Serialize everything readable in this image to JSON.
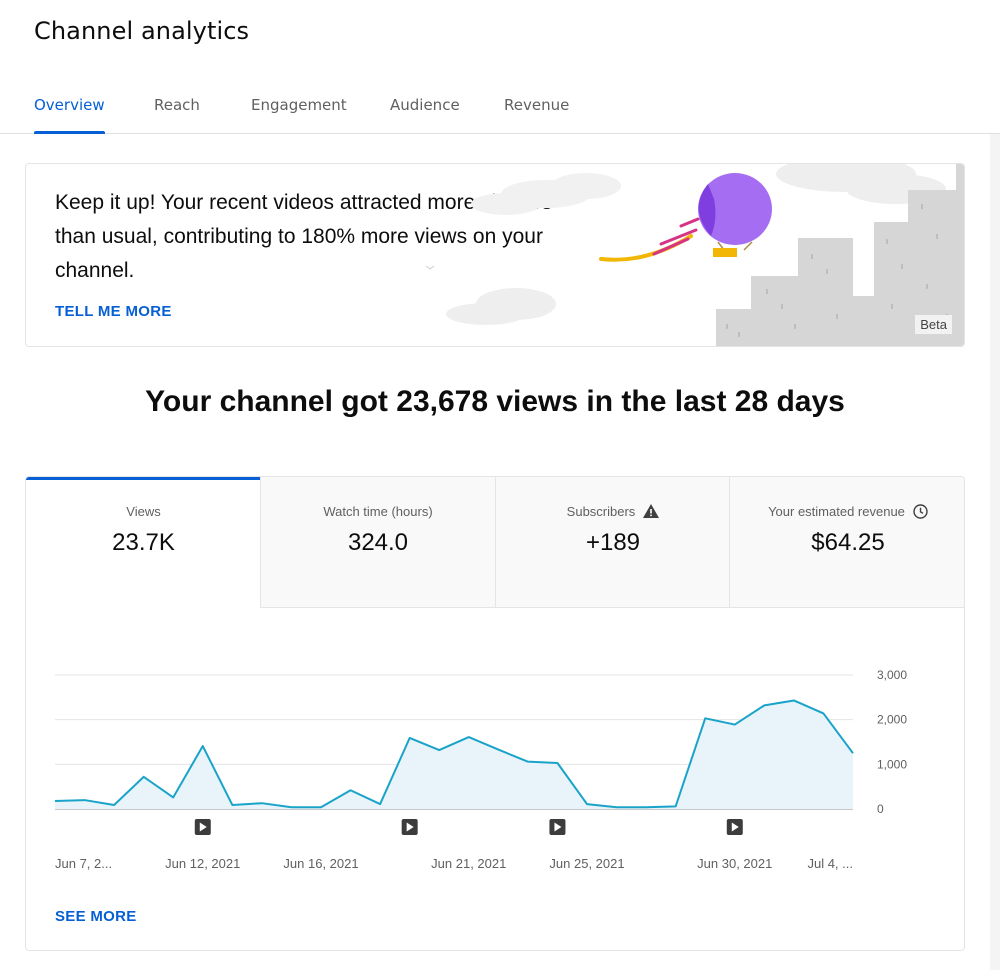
{
  "page": {
    "title": "Channel analytics"
  },
  "tabs": [
    {
      "label": "Overview",
      "active": true
    },
    {
      "label": "Reach"
    },
    {
      "label": "Engagement"
    },
    {
      "label": "Audience"
    },
    {
      "label": "Revenue"
    }
  ],
  "banner": {
    "message": "Keep it up! Your recent videos attracted more viewers than usual, contributing to 180% more views on your channel.",
    "link_label": "TELL ME MORE",
    "badge": "Beta"
  },
  "headline": "Your channel got 23,678 views in the last 28 days",
  "metrics": [
    {
      "label": "Views",
      "value": "23.7K",
      "active": true
    },
    {
      "label": "Watch time (hours)",
      "value": "324.0"
    },
    {
      "label": "Subscribers",
      "value": "+189",
      "icon": "warning-icon"
    },
    {
      "label": "Your estimated revenue",
      "value": "$64.25",
      "icon": "clock-icon"
    }
  ],
  "see_more_label": "SEE MORE",
  "colors": {
    "accent": "#065fd4",
    "line": "#1aa3c9",
    "fill": "#e8f4fa"
  },
  "chart_data": {
    "type": "area",
    "y_ticks": [
      "3,000",
      "2,000",
      "1,000",
      "0"
    ],
    "ylim": [
      0,
      3000
    ],
    "x_tick_labels": [
      "Jun 7, 2...",
      "Jun 12, 2021",
      "Jun 16, 2021",
      "Jun 21, 2021",
      "Jun 25, 2021",
      "Jun 30, 2021",
      "Jul 4, ..."
    ],
    "x_tick_index": [
      0,
      5,
      9,
      14,
      18,
      23,
      26
    ],
    "x": [
      "Jun 7",
      "Jun 8",
      "Jun 9",
      "Jun 10",
      "Jun 11",
      "Jun 12",
      "Jun 13",
      "Jun 14",
      "Jun 15",
      "Jun 16",
      "Jun 17",
      "Jun 18",
      "Jun 19",
      "Jun 20",
      "Jun 21",
      "Jun 22",
      "Jun 23",
      "Jun 24",
      "Jun 25",
      "Jun 26",
      "Jun 27",
      "Jun 28",
      "Jun 29",
      "Jun 30",
      "Jul 1",
      "Jul 2",
      "Jul 3",
      "Jul 4",
      "Jul 5"
    ],
    "values": [
      180,
      200,
      90,
      720,
      260,
      1410,
      90,
      130,
      40,
      40,
      420,
      110,
      1590,
      1320,
      1610,
      1330,
      1060,
      1030,
      110,
      40,
      40,
      60,
      2030,
      1890,
      2320,
      2430,
      2140,
      1250
    ],
    "video_markers": [
      5,
      12,
      17,
      23
    ],
    "grid": true
  }
}
